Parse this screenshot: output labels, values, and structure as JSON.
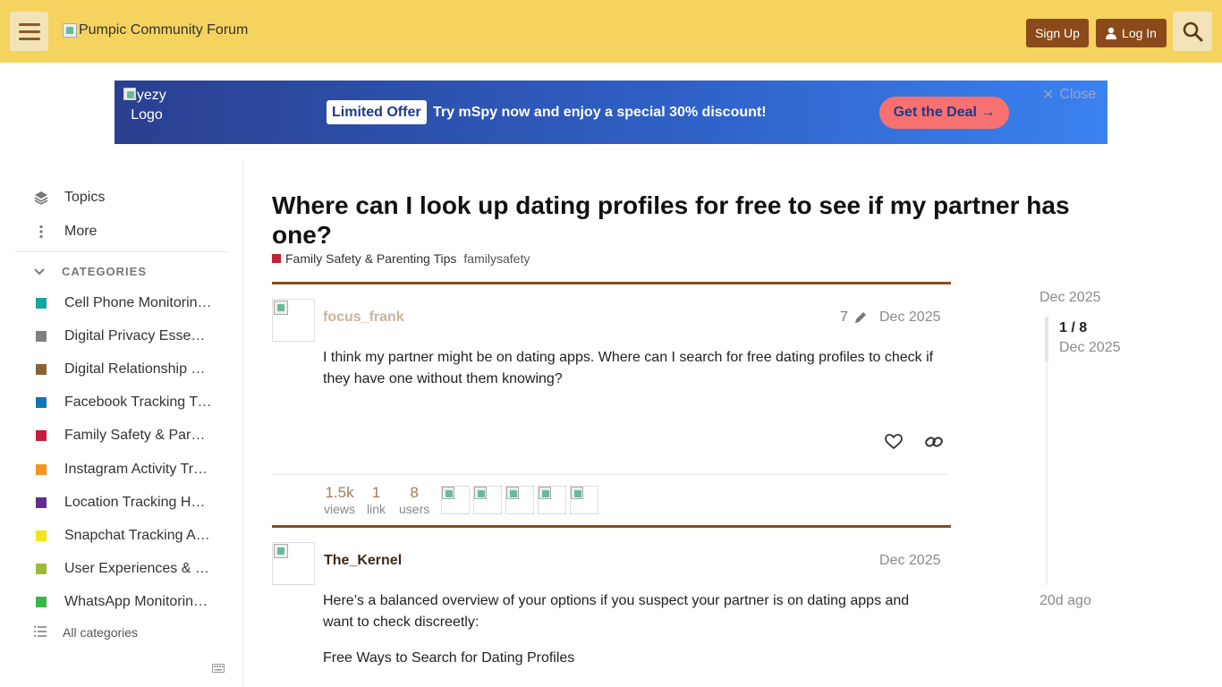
{
  "header": {
    "logo_alt": "Pumpic Community Forum",
    "signup_label": "Sign Up",
    "login_label": "Log In"
  },
  "banner": {
    "logo_alt": "Eyezy Logo",
    "offer_tag": "Limited Offer",
    "offer_text": "Try mSpy now and enjoy a special 30% discount!",
    "deal_label": "Get the Deal →",
    "close_label": "Close"
  },
  "sidebar": {
    "topics_label": "Topics",
    "more_label": "More",
    "categories_header": "CATEGORIES",
    "categories": [
      {
        "label": "Cell Phone Monitoring Tips",
        "color": "#12a89d"
      },
      {
        "label": "Digital Privacy Essentials",
        "color": "#808080"
      },
      {
        "label": "Digital Relationship Safety",
        "color": "#8c6238"
      },
      {
        "label": "Facebook Tracking Tips",
        "color": "#0e76bd"
      },
      {
        "label": "Family Safety & Parenting Tips",
        "color": "#c41e3a"
      },
      {
        "label": "Instagram Activity Tracking",
        "color": "#f7941d"
      },
      {
        "label": "Location Tracking Hacks",
        "color": "#652d90"
      },
      {
        "label": "Snapchat Tracking Apps",
        "color": "#f1e51d"
      },
      {
        "label": "User Experiences & Reviews",
        "color": "#9eb83b"
      },
      {
        "label": "WhatsApp Monitoring Tips",
        "color": "#3ab54a"
      }
    ],
    "all_categories_label": "All categories"
  },
  "topic": {
    "title": "Where can I look up dating profiles for free to see if my partner has one?",
    "category": "Family Safety & Parenting Tips",
    "tag": "familysafety"
  },
  "posts": [
    {
      "username": "focus_frank",
      "edits": "7",
      "date": "Dec 2025",
      "body": "I think my partner might be on dating apps. Where can I search for free dating profiles to check if they have one without them knowing?"
    },
    {
      "username": "The_Kernel",
      "date": "Dec 2025",
      "body_p1": "Here’s a balanced overview of your options if you suspect your partner is on dating apps and want to check discreetly:",
      "body_p2": "Free Ways to Search for Dating Profiles"
    }
  ],
  "topic_map": {
    "views": "1.5k",
    "views_label": "views",
    "links": "1",
    "links_label": "link",
    "users": "8",
    "users_label": "users"
  },
  "timeline": {
    "top_date": "Dec 2025",
    "position": "1 / 8",
    "position_date": "Dec 2025",
    "bottom": "20d ago"
  },
  "colors": {
    "header_bg": "#f5d35f",
    "brand_brown": "#8b4a1a",
    "link_tan": "#a67c52"
  }
}
